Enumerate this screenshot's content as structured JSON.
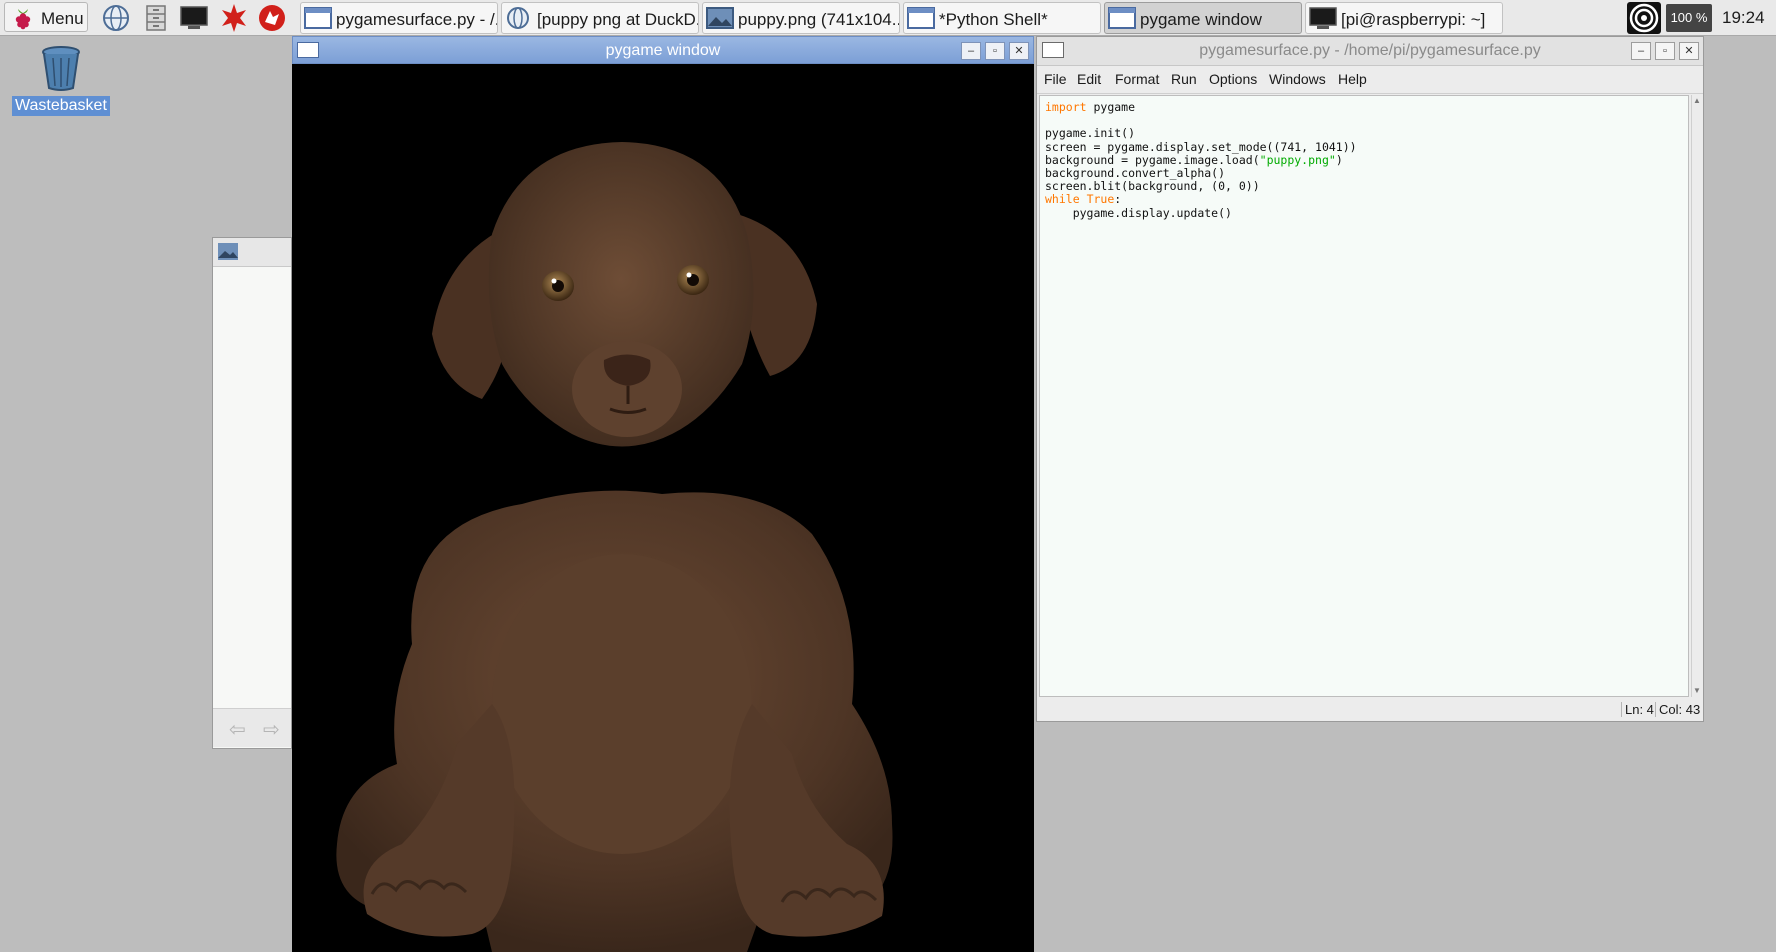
{
  "taskbar": {
    "menu_label": "Menu",
    "launchers": [
      "web-browser-icon",
      "file-manager-icon",
      "terminal-icon",
      "mathematica-icon",
      "wolfram-icon"
    ],
    "tasks": [
      {
        "label": "pygamesurface.py - /...",
        "icon": "idle-window-icon",
        "active": false
      },
      {
        "label": "[puppy png at DuckD...",
        "icon": "browser-globe-icon",
        "active": false
      },
      {
        "label": "puppy.png (741x104...",
        "icon": "image-viewer-icon",
        "active": false
      },
      {
        "label": "*Python Shell*",
        "icon": "idle-window-icon",
        "active": false
      },
      {
        "label": "pygame window",
        "icon": "window-icon",
        "active": true
      },
      {
        "label": "[pi@raspberrypi: ~]",
        "icon": "terminal-icon",
        "active": false
      }
    ],
    "cpu": "100 %",
    "clock": "19:24"
  },
  "desktop": {
    "wastebasket_label": "Wastebasket"
  },
  "pygame_window": {
    "title": "pygame window",
    "content": "brown-puppy-photo"
  },
  "idle": {
    "title": "pygamesurface.py - /home/pi/pygamesurface.py",
    "menus": [
      "File",
      "Edit",
      "Format",
      "Run",
      "Options",
      "Windows",
      "Help"
    ],
    "code_lines": [
      [
        {
          "t": "import",
          "c": "kw"
        },
        {
          "t": " pygame",
          "c": ""
        }
      ],
      [],
      [
        {
          "t": "pygame.init()",
          "c": ""
        }
      ],
      [
        {
          "t": "screen = pygame.display.set_mode((741, 1041))",
          "c": ""
        }
      ],
      [
        {
          "t": "background = pygame.image.load(",
          "c": ""
        },
        {
          "t": "\"puppy.png\"",
          "c": "str"
        },
        {
          "t": ")",
          "c": ""
        }
      ],
      [
        {
          "t": "background.convert_alpha()",
          "c": ""
        }
      ],
      [
        {
          "t": "screen.blit(background, (0, 0))",
          "c": ""
        }
      ],
      [
        {
          "t": "while",
          "c": "kw"
        },
        {
          "t": " ",
          "c": ""
        },
        {
          "t": "True",
          "c": "kw"
        },
        {
          "t": ":",
          "c": ""
        }
      ],
      [
        {
          "t": "    pygame.display.update()",
          "c": ""
        }
      ]
    ],
    "status_line": "Ln: 4",
    "status_col": "Col: 43"
  },
  "colors": {
    "keyword": "#ff7700",
    "string": "#00aa00",
    "titlebar_active": "#7c9fd6",
    "editor_bg": "#f6fbf8"
  }
}
